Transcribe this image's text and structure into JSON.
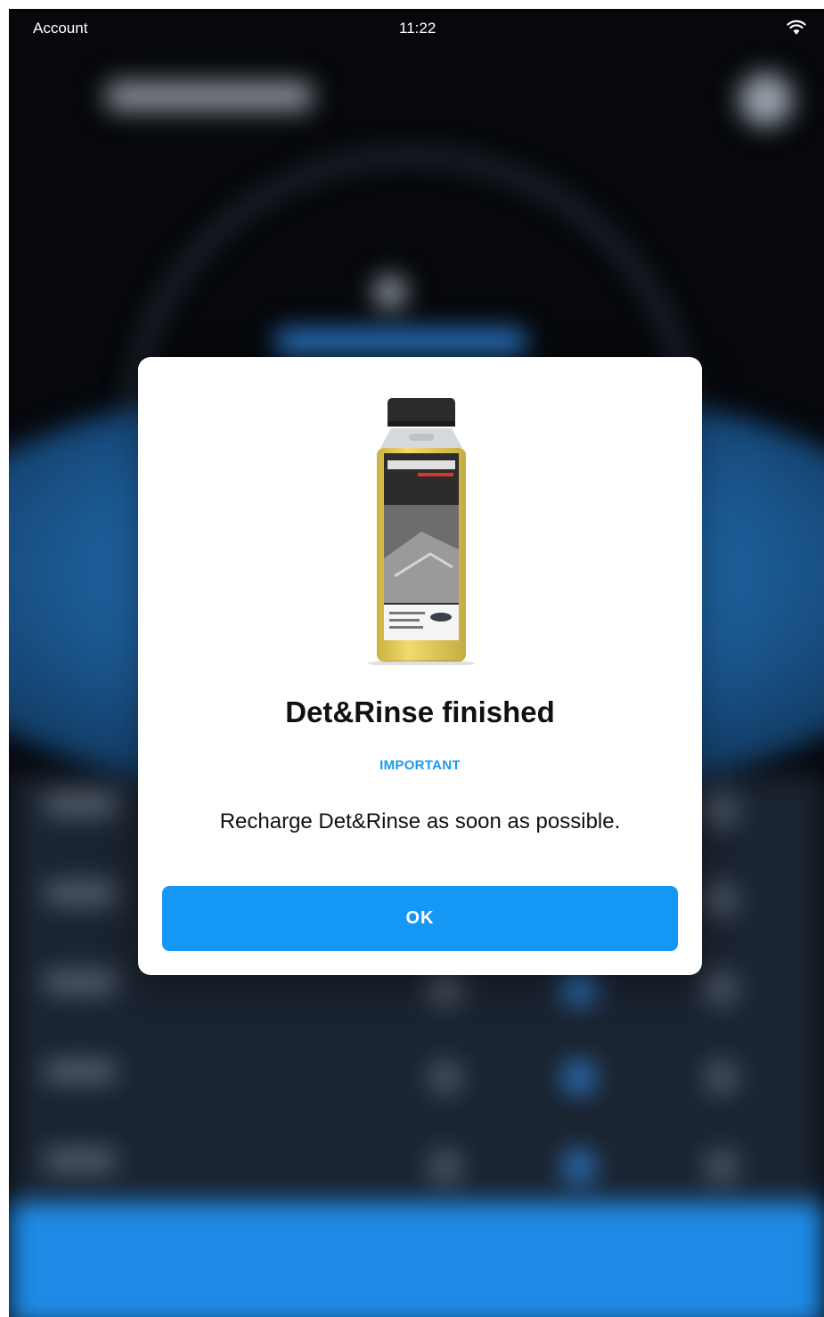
{
  "status_bar": {
    "left_label": "Account",
    "time": "11:22",
    "wifi_icon": "wifi-icon"
  },
  "dialog": {
    "product_image_icon": "detergent-bottle-image",
    "title": "Det&Rinse finished",
    "tag": "IMPORTANT",
    "message": "Recharge Det&Rinse as soon as possible.",
    "ok_label": "OK"
  },
  "colors": {
    "accent": "#1597f5",
    "tag": "#1a9bf0",
    "product_label": "#f2d64a"
  }
}
